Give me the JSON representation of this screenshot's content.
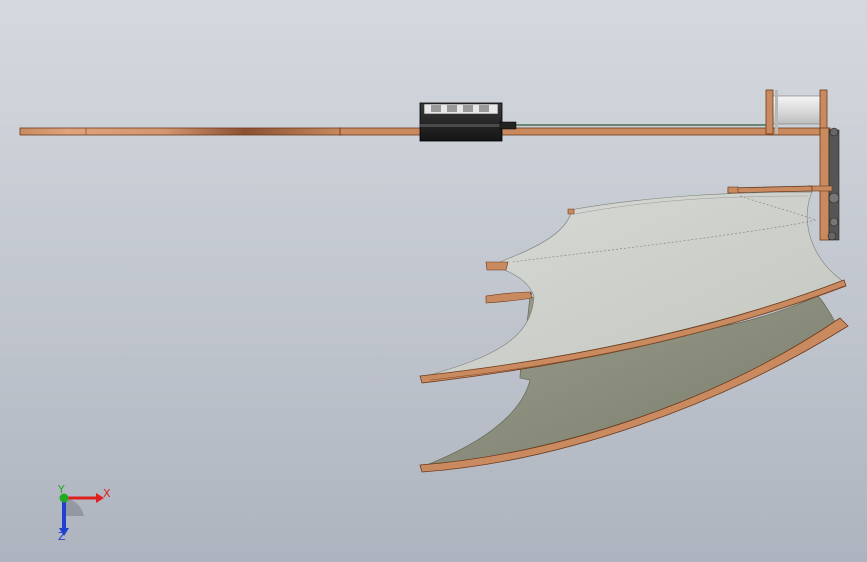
{
  "viewport": {
    "background_colors": [
      "#d5d9df",
      "#aeb4bf"
    ]
  },
  "model": {
    "wood_color": "#c87f55",
    "wood_edge_color": "#6b3a1c",
    "fabric_top_color": "#d3d6d0",
    "fabric_under_color": "#8a8c7c",
    "motor_color": "#2b2b2b"
  },
  "triad": {
    "x_label": "X",
    "y_label": "Y",
    "z_label": "Z",
    "x_color": "#e02020",
    "y_color": "#22aa22",
    "z_color": "#2040d0"
  }
}
